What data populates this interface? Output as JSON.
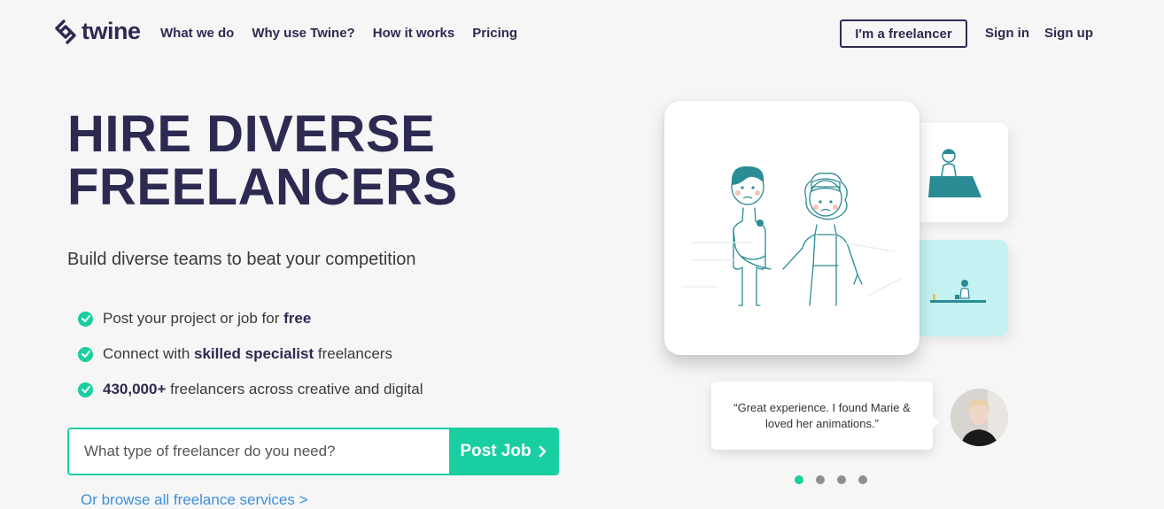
{
  "header": {
    "logo_text": "twine",
    "nav": [
      "What we do",
      "Why use Twine?",
      "How it works",
      "Pricing"
    ],
    "freelancer_button": "I'm a freelancer",
    "sign_in": "Sign in",
    "sign_up": "Sign up"
  },
  "hero": {
    "title_line1": "HIRE DIVERSE",
    "title_line2": "FREELANCERS",
    "subtitle": "Build diverse teams to beat your competition",
    "features": [
      {
        "before": "Post your project or job for ",
        "bold": "free",
        "after": ""
      },
      {
        "before": "Connect with ",
        "bold": "skilled specialist",
        "after": " freelancers"
      },
      {
        "before": "",
        "bold": "430,000+",
        "after": " freelancers across creative and digital"
      }
    ],
    "search_placeholder": "What type of freelancer do you need?",
    "post_button": "Post Job",
    "browse_link": "Or browse all freelance services >"
  },
  "testimonial": {
    "quote": "“Great experience. I found Marie & loved her animations.”"
  },
  "carousel": {
    "slides": 4,
    "active_index": 0
  },
  "colors": {
    "brand": "#2d2a52",
    "accent": "#19cfa1",
    "link": "#3b8fd9",
    "teal_card": "#c4f1f1"
  },
  "icons": [
    "twine-logo-icon",
    "check-icon",
    "chevron-right-icon"
  ]
}
